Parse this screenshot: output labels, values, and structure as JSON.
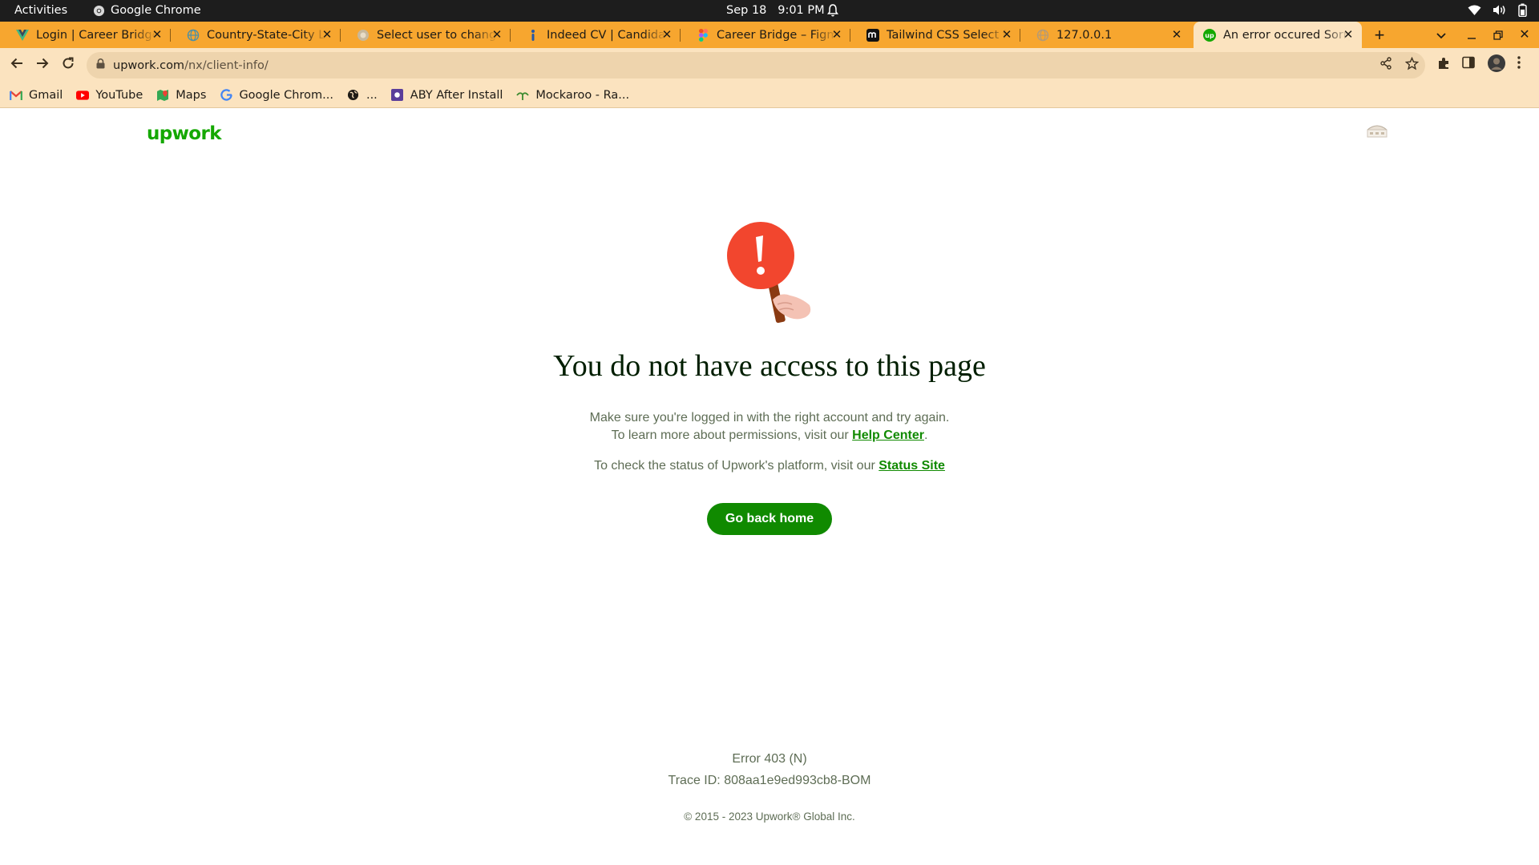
{
  "system_bar": {
    "activities": "Activities",
    "app_name": "Google Chrome",
    "date": "Sep 18",
    "time": "9:01 PM"
  },
  "tabs": [
    {
      "title": "Login | Career Bridge",
      "icon": "vue-logo-icon"
    },
    {
      "title": "Country-State-City List",
      "icon": "globe-icon"
    },
    {
      "title": "Select user to change",
      "icon": "django-icon"
    },
    {
      "title": "Indeed CV | Candidate",
      "icon": "indeed-icon"
    },
    {
      "title": "Career Bridge – Figma",
      "icon": "figma-icon"
    },
    {
      "title": "Tailwind CSS Select for",
      "icon": "tailwind-icon"
    },
    {
      "title": "127.0.0.1",
      "icon": "globe-icon"
    },
    {
      "title": "An error occured Sorry",
      "icon": "upwork-icon",
      "active": true
    }
  ],
  "address_bar": {
    "host": "upwork.com",
    "path": "/nx/client-info/"
  },
  "bookmarks": [
    {
      "label": "Gmail",
      "icon": "gmail-icon"
    },
    {
      "label": "YouTube",
      "icon": "youtube-icon"
    },
    {
      "label": "Maps",
      "icon": "maps-icon"
    },
    {
      "label": "Google Chrom...",
      "icon": "google-icon"
    },
    {
      "label": "...",
      "icon": "globe-icon"
    },
    {
      "label": "ABY After Install",
      "icon": "aby-icon"
    },
    {
      "label": "Mockaroo - Ra...",
      "icon": "mockaroo-icon"
    }
  ],
  "page": {
    "logo": "upwork",
    "heading": "You do not have access to this page",
    "line1": "Make sure you're logged in with the right account and try again.",
    "line2_prefix": "To learn more about permissions, visit our ",
    "help_link": "Help Center",
    "line2_suffix": ".",
    "line3_prefix": "To check the status of Upwork's platform, visit our ",
    "status_link": "Status Site",
    "button": "Go back home",
    "error_code": "Error 403 (N)",
    "trace": "Trace ID: 808aa1e9ed993cb8-BOM",
    "copyright": "© 2015 - 2023 Upwork® Global Inc."
  },
  "colors": {
    "tab_strip": "#f7a62f",
    "toolbar": "#fbe3bf",
    "brand_green": "#14a800",
    "button_green": "#108a00",
    "alert_red": "#f2462e"
  }
}
